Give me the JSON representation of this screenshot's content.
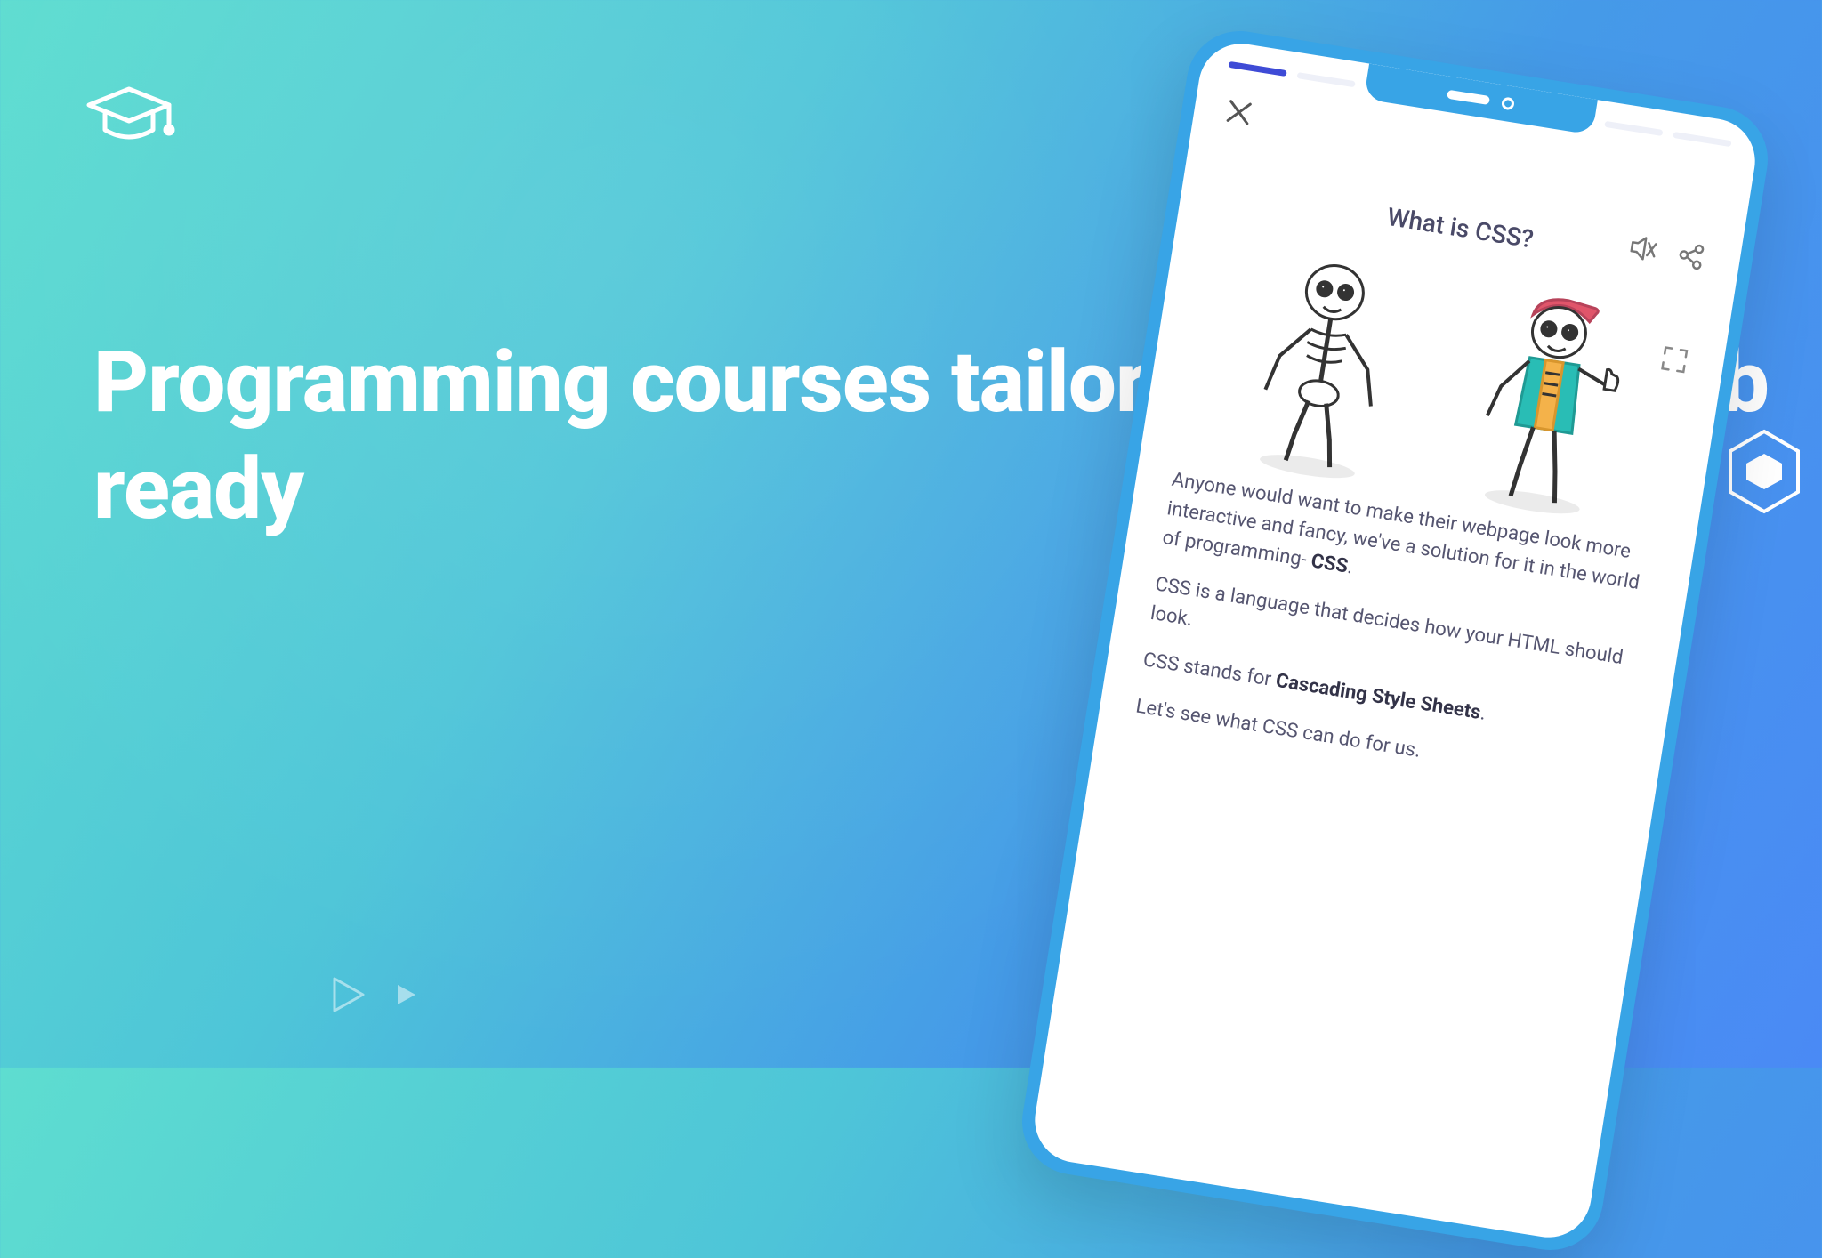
{
  "hero": {
    "headline": "Programming courses tailored to get you job ready"
  },
  "phone": {
    "lesson_title": "What is CSS?",
    "paragraphs": {
      "p1_a": "Anyone would want to make their webpage look more interactive and fancy, we've a solution for it in the world of programming- ",
      "p1_b": "CSS",
      "p1_c": ".",
      "p2": "CSS is a language that decides how your HTML should look.",
      "p3_a": "CSS stands for ",
      "p3_b": "Cascading Style Sheets",
      "p3_c": ".",
      "p4": "Let's see what CSS can do for us."
    }
  }
}
